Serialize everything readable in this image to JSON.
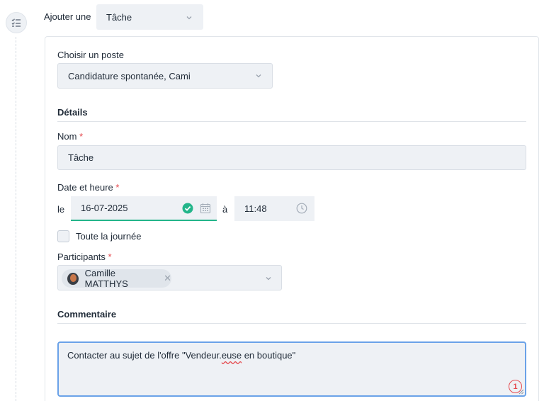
{
  "header": {
    "add_label": "Ajouter une",
    "type_value": "Tâche"
  },
  "form": {
    "poste_label": "Choisir un poste",
    "poste_value": "Candidature spontanée, Cami",
    "details_title": "Détails",
    "nom_label": "Nom",
    "nom_value": "Tâche",
    "date_label": "Date et heure",
    "date_prefix": "le",
    "date_value": "16-07-2025",
    "time_prefix": "à",
    "time_value": "11:48",
    "allday_label": "Toute la journée",
    "participants_label": "Participants",
    "participant_chip": "Camille MATTHYS",
    "required_mark": "*",
    "comment_title": "Commentaire",
    "comment_before": "Contacter au sujet de l'offre \"Vendeur.",
    "comment_misspelled": "euse",
    "comment_after": " en boutique\"",
    "counter": "1"
  },
  "colors": {
    "accent_green": "#23b58a",
    "focus_blue": "#6aa2e8",
    "required_red": "#e5484d",
    "field_bg": "#eef1f5"
  }
}
